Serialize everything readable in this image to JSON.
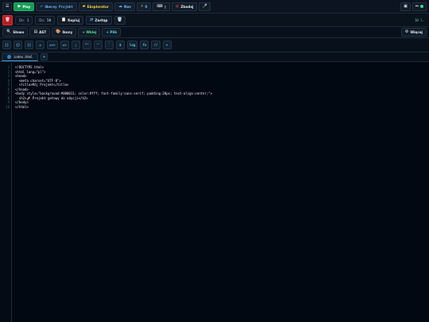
{
  "topbar": {
    "menu_icon": "hamburger-icon",
    "play_label": "Play",
    "project_label": "Obecny Projekt",
    "explorer_label": "Eksplorator",
    "new_label": "Nav",
    "counter_label": "0",
    "keyboard_label": "▯",
    "find_label": "Zbadaj",
    "settings_icon": "gear-icon",
    "layout_icon": "layout-icon"
  },
  "secondbar": {
    "stop_icon": "trash-icon",
    "from_label": "Do:",
    "from_value": "1",
    "to_label": "Do:",
    "to_value": "50",
    "copy_label": "Kopiuj",
    "replace_label": "Zastąp",
    "lines_label": "10 l."
  },
  "thirdbar": {
    "words_label": "Słowo",
    "ast_label": "AST",
    "icons_label": "Ikony",
    "paste_label": "+ Wklej",
    "file_label": "+ Plik",
    "more_label": "Więcej"
  },
  "symbols": [
    "[]",
    "{}",
    "[]",
    "=",
    "=>>",
    "=>",
    ";",
    "\"\"",
    "''",
    "`",
    "$",
    "log",
    "fn",
    "//",
    "+"
  ],
  "tab": {
    "name": "index.html",
    "add_label": "+"
  },
  "code_lines": [
    "<!DOCTYPE html>",
    "<html lang=\"pl\">",
    "<head>",
    "  <meta charset=\"UTF-8\">",
    "  <title>Mój Projekt</title>",
    "</head>",
    "<body style=\"background:#000011; color:#fff; font-family:sans-serif; padding:20px; text-align:center;\">",
    "  <h2>🚀 Projekt gotowy do edycji</h2>",
    "</body>",
    "</html>"
  ],
  "colors": {
    "background": "#020812",
    "play": "#159a55",
    "stop": "#b51d24",
    "accent_cyan": "#46dcf0",
    "accent_yellow": "#ffcd3a"
  }
}
